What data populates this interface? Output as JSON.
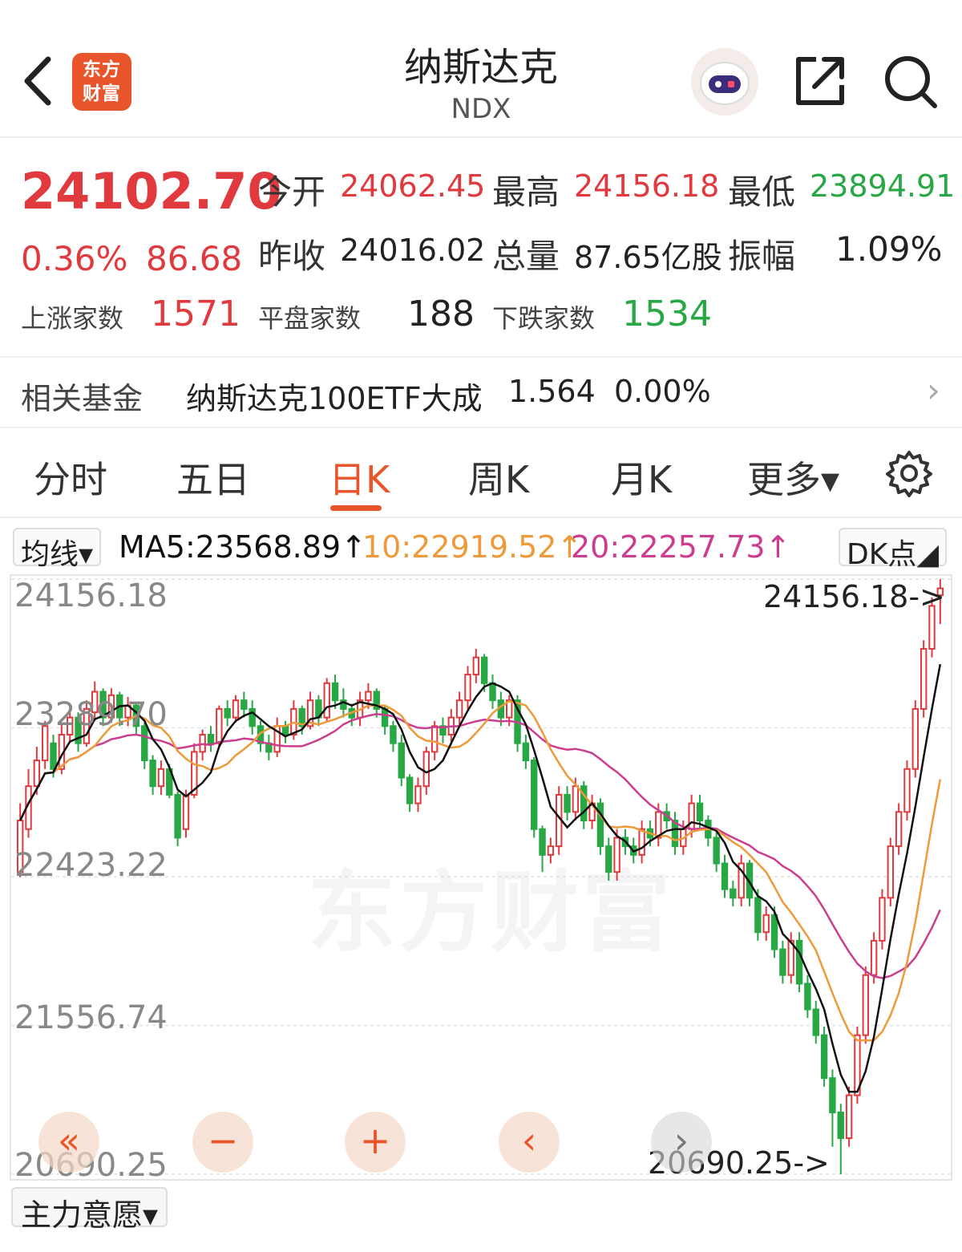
{
  "header": {
    "title": "纳斯达克",
    "subtitle": "NDX",
    "logo_line1": "东方",
    "logo_line2": "财富"
  },
  "quote": {
    "price": "24102.70",
    "change_pct": "0.36%",
    "change": "86.68",
    "open_label": "今开",
    "open": "24062.45",
    "high_label": "最高",
    "high": "24156.18",
    "low_label": "最低",
    "low": "23894.91",
    "prev_close_label": "昨收",
    "prev_close": "24016.02",
    "volume_label": "总量",
    "volume": "87.65亿股",
    "amplitude_label": "振幅",
    "amplitude": "1.09%",
    "up_label": "上涨家数",
    "up_count": "1571",
    "flat_label": "平盘家数",
    "flat_count": "188",
    "down_label": "下跌家数",
    "down_count": "1534"
  },
  "fund": {
    "label": "相关基金",
    "name": "纳斯达克100ETF大成",
    "price": "1.564",
    "change": "0.00%",
    "chevron": "›"
  },
  "tabs": [
    {
      "label": "分时"
    },
    {
      "label": "五日"
    },
    {
      "label": "日K"
    },
    {
      "label": "周K"
    },
    {
      "label": "月K"
    },
    {
      "label": "更多▾"
    }
  ],
  "active_tab": "日K",
  "ma_bar": {
    "dropdown": "均线▾",
    "ma5": "MA5:23568.89↑",
    "ma10": "10:22919.52↑",
    "ma20": "20:22257.73↑",
    "dk": "DK点◢"
  },
  "chart_labels": {
    "y1": "24156.18",
    "y2": "23289.70",
    "y3": "22423.22",
    "y4": "21556.74",
    "y5": "20690.25",
    "max_marker": "24156.18->",
    "min_marker": "20690.25->",
    "watermark": "东方财富"
  },
  "controls": {
    "rewind": "«",
    "zoom_out": "−",
    "zoom_in": "+",
    "prev": "‹",
    "next": "›"
  },
  "bottom_dropdown": "主力意愿▾",
  "colors": {
    "up": "#e0393e",
    "down": "#28a745",
    "accent": "#e8552a",
    "ma5": "#111111",
    "ma10": "#ee9a3a",
    "ma20": "#cc3d8f"
  },
  "icons": [
    "back-icon",
    "share-icon",
    "search-icon",
    "gear-icon",
    "robot-avatar-icon"
  ],
  "chart_data": {
    "type": "candlestick",
    "ylim": [
      20690.25,
      24156.18
    ],
    "gridlines": [
      24156.18,
      23289.7,
      22423.22,
      21556.74,
      20690.25
    ],
    "candles": [
      [
        22450,
        22750,
        22420,
        22850
      ],
      [
        22700,
        22950,
        22650,
        23050
      ],
      [
        22950,
        23100,
        22900,
        23180
      ],
      [
        23100,
        23300,
        23050,
        23330
      ],
      [
        23200,
        23050,
        23000,
        23250
      ],
      [
        23050,
        23250,
        23020,
        23320
      ],
      [
        23250,
        23350,
        23200,
        23420
      ],
      [
        23350,
        23200,
        23150,
        23380
      ],
      [
        23200,
        23400,
        23180,
        23450
      ],
      [
        23380,
        23500,
        23330,
        23560
      ],
      [
        23500,
        23350,
        23300,
        23520
      ],
      [
        23350,
        23480,
        23320,
        23520
      ],
      [
        23480,
        23350,
        23300,
        23500
      ],
      [
        23350,
        23420,
        23300,
        23470
      ],
      [
        23420,
        23300,
        23250,
        23440
      ],
      [
        23300,
        23100,
        23050,
        23320
      ],
      [
        23100,
        22950,
        22900,
        23130
      ],
      [
        22950,
        23050,
        22900,
        23100
      ],
      [
        23050,
        22900,
        22880,
        23080
      ],
      [
        22900,
        22650,
        22600,
        22920
      ],
      [
        22700,
        22900,
        22650,
        22930
      ],
      [
        22900,
        23150,
        22880,
        23200
      ],
      [
        23150,
        23250,
        23100,
        23280
      ],
      [
        23250,
        23200,
        23150,
        23300
      ],
      [
        23200,
        23400,
        23180,
        23420
      ],
      [
        23400,
        23350,
        23300,
        23450
      ],
      [
        23350,
        23450,
        23320,
        23480
      ],
      [
        23450,
        23400,
        23350,
        23500
      ],
      [
        23400,
        23300,
        23250,
        23450
      ],
      [
        23300,
        23200,
        23150,
        23330
      ],
      [
        23200,
        23150,
        23100,
        23250
      ],
      [
        23150,
        23300,
        23120,
        23350
      ],
      [
        23300,
        23250,
        23200,
        23330
      ],
      [
        23250,
        23400,
        23220,
        23450
      ],
      [
        23400,
        23300,
        23250,
        23420
      ],
      [
        23300,
        23450,
        23280,
        23500
      ],
      [
        23450,
        23350,
        23300,
        23480
      ],
      [
        23350,
        23550,
        23320,
        23580
      ],
      [
        23550,
        23450,
        23400,
        23600
      ],
      [
        23450,
        23400,
        23350,
        23520
      ],
      [
        23400,
        23350,
        23300,
        23430
      ],
      [
        23350,
        23450,
        23300,
        23500
      ],
      [
        23450,
        23500,
        23400,
        23550
      ],
      [
        23500,
        23400,
        23350,
        23520
      ],
      [
        23400,
        23300,
        23250,
        23420
      ],
      [
        23300,
        23200,
        23150,
        23330
      ],
      [
        23200,
        23000,
        22950,
        23250
      ],
      [
        23000,
        22850,
        22800,
        23020
      ],
      [
        22850,
        22950,
        22800,
        23000
      ],
      [
        22950,
        23150,
        22900,
        23180
      ],
      [
        23150,
        23300,
        23100,
        23330
      ],
      [
        23300,
        23250,
        23200,
        23350
      ],
      [
        23250,
        23350,
        23200,
        23400
      ],
      [
        23350,
        23450,
        23300,
        23500
      ],
      [
        23450,
        23600,
        23400,
        23650
      ],
      [
        23600,
        23700,
        23550,
        23750
      ],
      [
        23700,
        23550,
        23500,
        23720
      ],
      [
        23550,
        23450,
        23400,
        23600
      ],
      [
        23450,
        23350,
        23300,
        23500
      ],
      [
        23350,
        23450,
        23300,
        23480
      ],
      [
        23450,
        23200,
        23150,
        23480
      ],
      [
        23200,
        23100,
        23050,
        23250
      ],
      [
        23100,
        22700,
        22650,
        23120
      ],
      [
        22700,
        22550,
        22450,
        22720
      ],
      [
        22550,
        22600,
        22500,
        22650
      ],
      [
        22600,
        22900,
        22550,
        22950
      ],
      [
        22900,
        22800,
        22750,
        22950
      ],
      [
        22800,
        22950,
        22750,
        23000
      ],
      [
        22950,
        22750,
        22700,
        22980
      ],
      [
        22750,
        22850,
        22700,
        22900
      ],
      [
        22850,
        22600,
        22550,
        22880
      ],
      [
        22600,
        22450,
        22400,
        22650
      ],
      [
        22450,
        22650,
        22400,
        22700
      ],
      [
        22650,
        22600,
        22550,
        22700
      ],
      [
        22600,
        22550,
        22500,
        22650
      ],
      [
        22550,
        22700,
        22500,
        22750
      ],
      [
        22700,
        22650,
        22600,
        22750
      ],
      [
        22650,
        22800,
        22600,
        22850
      ],
      [
        22800,
        22750,
        22700,
        22850
      ],
      [
        22750,
        22600,
        22550,
        22800
      ],
      [
        22600,
        22700,
        22550,
        22750
      ],
      [
        22700,
        22850,
        22650,
        22900
      ],
      [
        22850,
        22750,
        22700,
        22900
      ],
      [
        22750,
        22650,
        22600,
        22780
      ],
      [
        22650,
        22500,
        22450,
        22700
      ],
      [
        22500,
        22350,
        22300,
        22550
      ],
      [
        22350,
        22300,
        22250,
        22400
      ],
      [
        22300,
        22500,
        22250,
        22550
      ],
      [
        22500,
        22300,
        22250,
        22520
      ],
      [
        22300,
        22100,
        22050,
        22350
      ],
      [
        22100,
        22200,
        22050,
        22250
      ],
      [
        22200,
        22000,
        21950,
        22250
      ],
      [
        22000,
        21850,
        21800,
        22050
      ],
      [
        21850,
        22050,
        21800,
        22100
      ],
      [
        22050,
        21800,
        21750,
        22100
      ],
      [
        21800,
        21650,
        21600,
        21850
      ],
      [
        21650,
        21500,
        21450,
        21700
      ],
      [
        21500,
        21250,
        21200,
        21550
      ],
      [
        21250,
        21050,
        20850,
        21300
      ],
      [
        21050,
        20900,
        20690,
        21100
      ],
      [
        20900,
        21150,
        20850,
        21200
      ],
      [
        21150,
        21500,
        21100,
        21550
      ],
      [
        21500,
        21850,
        21450,
        21900
      ],
      [
        21850,
        22050,
        21800,
        22100
      ],
      [
        22050,
        22300,
        22000,
        22350
      ],
      [
        22300,
        22600,
        22250,
        22650
      ],
      [
        22600,
        22800,
        22550,
        22850
      ],
      [
        22800,
        23050,
        22750,
        23100
      ],
      [
        23050,
        23400,
        23000,
        23450
      ],
      [
        23400,
        23750,
        23350,
        23800
      ],
      [
        23750,
        24000,
        23700,
        24050
      ],
      [
        24062,
        24102,
        23894,
        24156
      ]
    ]
  }
}
